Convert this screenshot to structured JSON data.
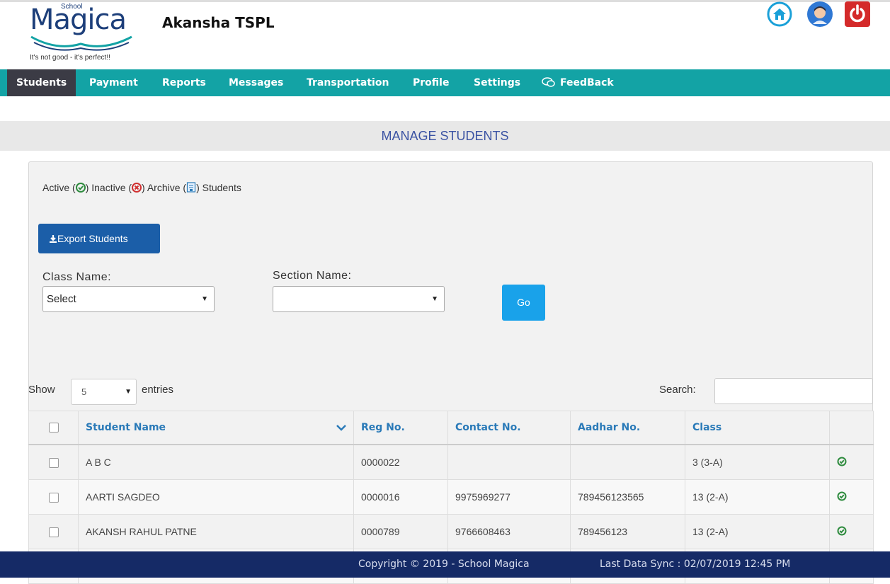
{
  "logo": {
    "school": "School",
    "brand": "Magica",
    "tagline": "It's not good - it's perfect!!"
  },
  "org_name": "Akansha TSPL",
  "header_icons": [
    "home-icon",
    "user-icon",
    "power-icon"
  ],
  "nav": {
    "items": [
      {
        "label": "Students",
        "active": true
      },
      {
        "label": "Payment"
      },
      {
        "label": "Reports"
      },
      {
        "label": "Messages"
      },
      {
        "label": "Transportation"
      },
      {
        "label": "Profile"
      },
      {
        "label": "Settings"
      },
      {
        "label": "FeedBack",
        "icon": "chat-icon"
      }
    ]
  },
  "page_title": "MANAGE STUDENTS",
  "legend": {
    "active": "Active (",
    "inactive": ") Inactive (",
    "archive": ") Archive (",
    "students": ") Students"
  },
  "export_label": "Export Students",
  "filters": {
    "class_label": "Class Name:",
    "class_value": "Select",
    "section_label": "Section Name:",
    "section_value": "",
    "go_label": "Go"
  },
  "table_controls": {
    "show_label": "Show",
    "entries_value": "5",
    "entries_label": "entries",
    "search_label": "Search:"
  },
  "table": {
    "headers": [
      "Student Name",
      "Reg No.",
      "Contact No.",
      "Aadhar No.",
      "Class"
    ],
    "rows": [
      {
        "name": "A B C",
        "reg": "0000022",
        "contact": "",
        "aadhar": "",
        "class": "3 (3-A)"
      },
      {
        "name": "AARTI SAGDEO",
        "reg": "0000016",
        "contact": "9975969277",
        "aadhar": "789456123565",
        "class": "13 (2-A)"
      },
      {
        "name": "AKANSH RAHUL PATNE",
        "reg": "0000789",
        "contact": "9766608463",
        "aadhar": "789456123",
        "class": "13 (2-A)"
      },
      {
        "name": "",
        "reg": "",
        "contact": "",
        "aadhar": "",
        "class": ""
      }
    ]
  },
  "footer": {
    "copyright": "Copyright © 2019 - School Magica",
    "sync": "Last Data Sync : 02/07/2019 12:45 PM"
  },
  "colors": {
    "nav_bg": "#13a3a5",
    "nav_active": "#3b3b45",
    "title_text": "#3b53a3",
    "button_blue": "#1b5ea8",
    "go_blue": "#19a2ea",
    "footer_bg": "#152a66",
    "active_green": "#2e8b3e"
  }
}
